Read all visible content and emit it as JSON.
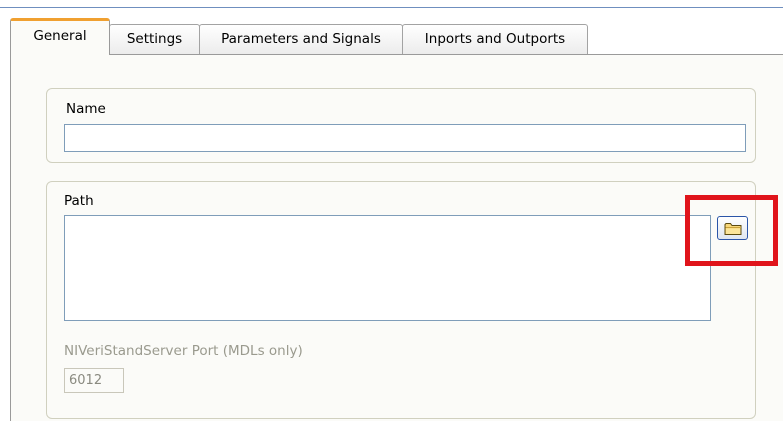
{
  "tabs": [
    {
      "label": "General",
      "active": true
    },
    {
      "label": "Settings",
      "active": false
    },
    {
      "label": "Parameters and Signals",
      "active": false
    },
    {
      "label": "Inports and Outports",
      "active": false
    }
  ],
  "name_group": {
    "label": "Name",
    "value": ""
  },
  "path_group": {
    "label": "Path",
    "value": "",
    "browse_icon": "folder-icon"
  },
  "port": {
    "label": "NIVeriStandServer Port (MDLs only)",
    "value": "6012",
    "enabled": false
  },
  "colors": {
    "active_tab_accent": "#f0a030",
    "highlight_box": "#e0141b",
    "input_border": "#7f9db9"
  }
}
